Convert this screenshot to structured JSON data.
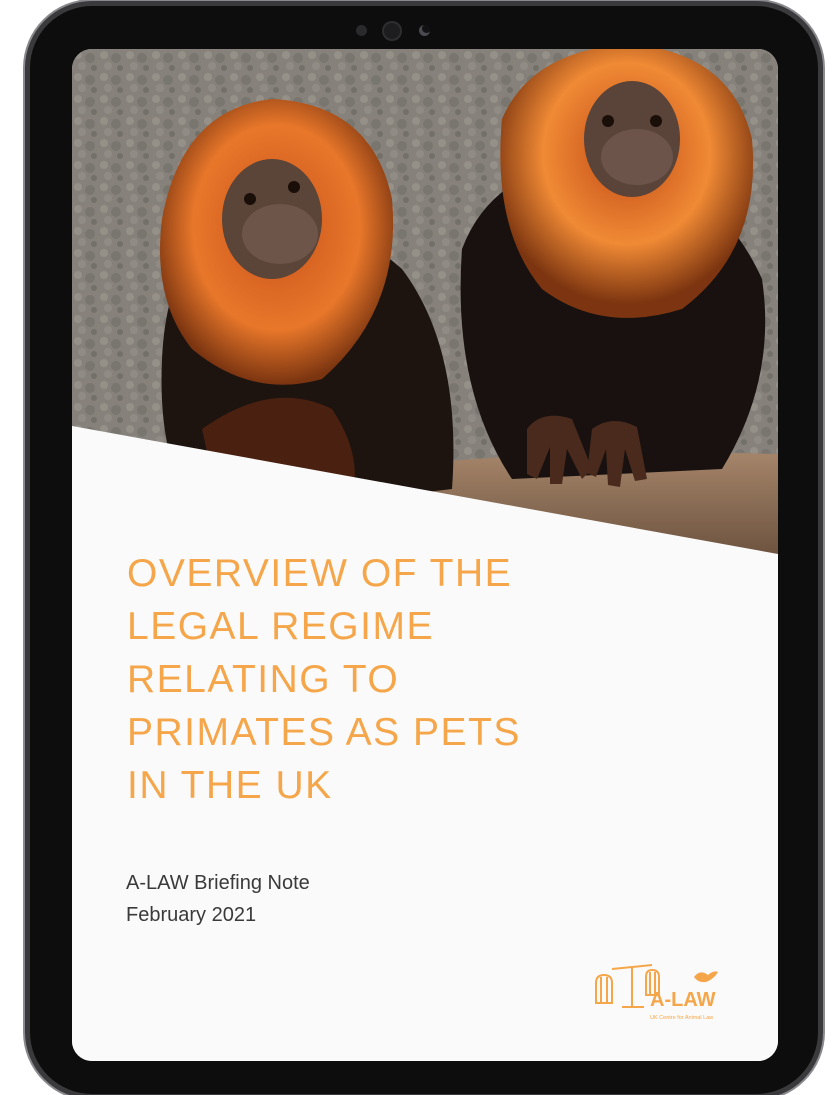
{
  "document": {
    "title_lines": [
      "OVERVIEW OF THE",
      "LEGAL REGIME",
      "RELATING TO",
      "PRIMATES AS PETS",
      "IN THE UK"
    ],
    "subtitle": "A-LAW Briefing Note",
    "date": "February 2021"
  },
  "logo": {
    "wordmark": "A-LAW",
    "tagline": "UK Centre for Animal Law"
  },
  "colors": {
    "title": "#f5a64a",
    "body_text": "#3a3a3a",
    "device_frame": "#0d0d0d",
    "page_background": "#fafafa"
  },
  "icons": {
    "photo": "golden-headed-lion-tamarins-photo",
    "logo": "a-law-scales-logo"
  }
}
